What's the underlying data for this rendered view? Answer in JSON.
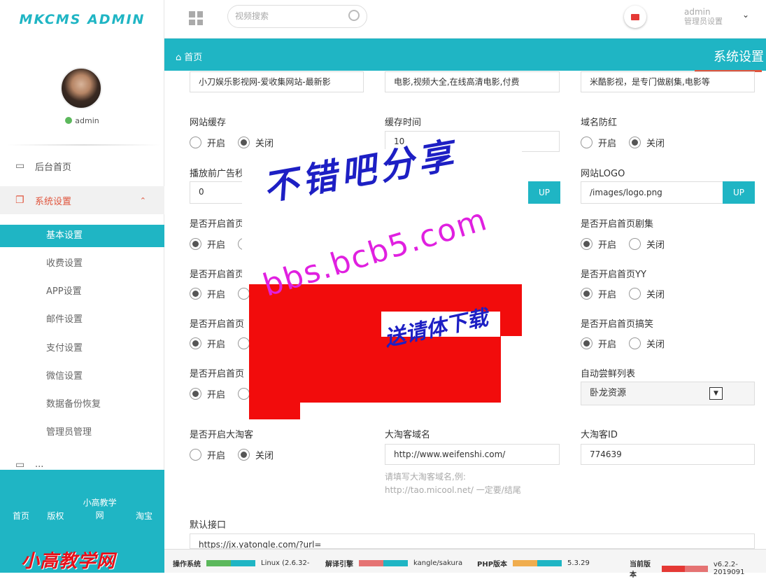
{
  "sidebar": {
    "logo": "MKCMS ADMIN",
    "username": "admin",
    "nav": [
      {
        "label": "后台首页"
      },
      {
        "label": "系统设置"
      },
      {
        "label": "..."
      }
    ],
    "sub": [
      "基本设置",
      "收费设置",
      "APP设置",
      "邮件设置",
      "支付设置",
      "微信设置",
      "数据备份恢复",
      "管理员管理"
    ],
    "footer_links": [
      "首页",
      "版权",
      "小高教学网",
      "淘宝"
    ],
    "footer_brand": "小高教学网"
  },
  "topbar": {
    "search_placeholder": "视频搜索",
    "admin_name": "admin",
    "admin_role": "管理员设置"
  },
  "titlebar": {
    "home": "首页",
    "page_title": "系统设置"
  },
  "form": {
    "top_values": [
      "小刀娱乐影视网-爱收集网站-最新影",
      "电影,视频大全,在线高清电影,付费",
      "米酷影视，是专门做剧集,电影等"
    ],
    "cache_label": "网站缓存",
    "cache_time_label": "缓存时间",
    "cache_time_value": "10",
    "domain_red_label": "域名防红",
    "ad_label": "播放前广告秒",
    "ad_value": "0",
    "logo_label": "网站LOGO",
    "logo_value": "/images/logo.png",
    "up": "UP",
    "on": "开启",
    "off": "关闭",
    "left_labels": [
      "是否开启首页",
      "是否开启首页",
      "是否开启首页",
      "是否开启首页"
    ],
    "right_labels": [
      "是否开启首页剧集",
      "是否开启首页YY",
      "是否开启首页搞笑"
    ],
    "auto_list_label": "自动尝鲜列表",
    "auto_list_value": "卧龙资源",
    "taoke_label": "是否开启大淘客",
    "taoke_domain_label": "大淘客域名",
    "taoke_domain_value": "http://www.weifenshi.com/",
    "taoke_hint_1": "请填写大淘客域名,例:",
    "taoke_hint_2": "http://tao.micool.net/ 一定要/结尾",
    "taoke_id_label": "大淘客ID",
    "taoke_id_value": "774639",
    "default_api_label": "默认接口",
    "default_api_value": "https://jx.yatongle.com/?url="
  },
  "watermark": {
    "line1": "不错吧分享",
    "line2": "bbs.bcb5.com",
    "line3": "送请体下载"
  },
  "statusbar": [
    {
      "label": "操作系统",
      "value": "Linux (2.6.32-",
      "c1": "#5cb85c",
      "c2": "#1fb5c4"
    },
    {
      "label": "解译引擎",
      "value": "kangle/sakura",
      "c1": "#e57373",
      "c2": "#1fb5c4"
    },
    {
      "label": "PHP版本",
      "value": "5.3.29",
      "c1": "#f0ad4e",
      "c2": "#1fb5c4"
    },
    {
      "label": "当前版本",
      "value": "v6.2.2-2019091",
      "c1": "#e53935",
      "c2": "#e57373"
    }
  ]
}
